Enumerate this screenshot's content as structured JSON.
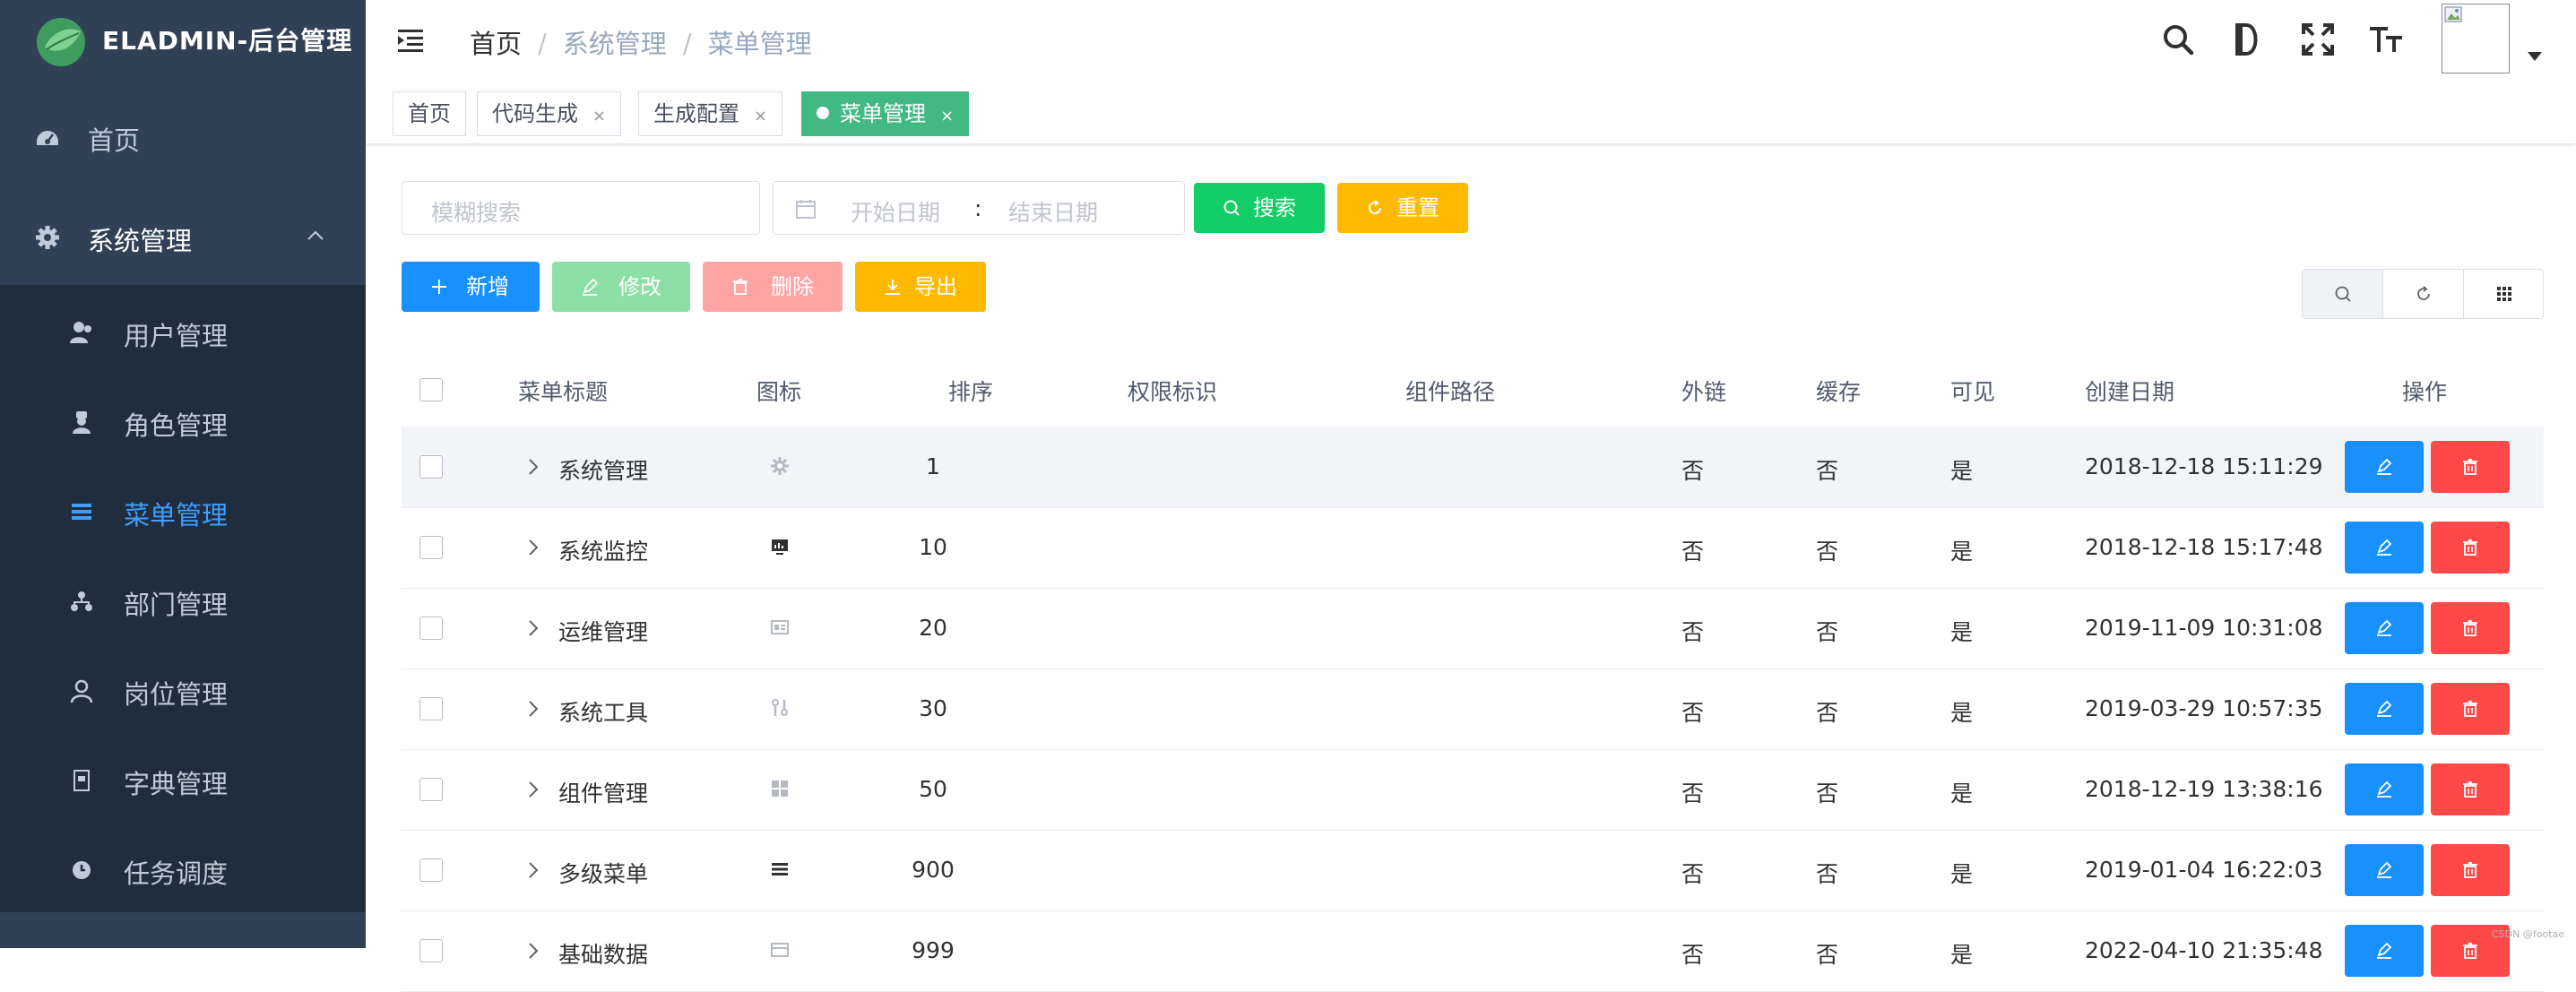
{
  "app": {
    "title": "ELADMIN-后台管理"
  },
  "sidebar": {
    "items": [
      {
        "label": "首页",
        "icon": "dashboard-icon"
      },
      {
        "label": "系统管理",
        "icon": "gear-icon",
        "expanded": true
      },
      {
        "label": "用户管理",
        "icon": "user-icon"
      },
      {
        "label": "角色管理",
        "icon": "role-icon"
      },
      {
        "label": "菜单管理",
        "icon": "menu-icon",
        "active": true
      },
      {
        "label": "部门管理",
        "icon": "dept-icon"
      },
      {
        "label": "岗位管理",
        "icon": "post-icon"
      },
      {
        "label": "字典管理",
        "icon": "dict-icon"
      },
      {
        "label": "任务调度",
        "icon": "timing-icon"
      }
    ]
  },
  "breadcrumb": [
    "首页",
    "系统管理",
    "菜单管理"
  ],
  "tags": [
    {
      "label": "首页"
    },
    {
      "label": "代码生成",
      "close": "×"
    },
    {
      "label": "生成配置",
      "close": "×"
    },
    {
      "label": "菜单管理",
      "close": "×",
      "active": true
    }
  ],
  "search": {
    "placeholder": "模糊搜索",
    "date_start_placeholder": "开始日期",
    "date_sep": ":",
    "date_end_placeholder": "结束日期",
    "search_label": "搜索",
    "reset_label": "重置"
  },
  "actions": {
    "add_label": "新增",
    "edit_label": "修改",
    "delete_label": "删除",
    "export_label": "导出"
  },
  "table": {
    "columns": [
      "菜单标题",
      "图标",
      "排序",
      "权限标识",
      "组件路径",
      "外链",
      "缓存",
      "可见",
      "创建日期",
      "操作"
    ],
    "rows": [
      {
        "title": "系统管理",
        "icon": "gear-icon",
        "sort": "1",
        "permission": "",
        "component": "",
        "iframe": "否",
        "cache": "否",
        "visible": "是",
        "created": "2018-12-18 15:11:29"
      },
      {
        "title": "系统监控",
        "icon": "monitor-icon",
        "sort": "10",
        "permission": "",
        "component": "",
        "iframe": "否",
        "cache": "否",
        "visible": "是",
        "created": "2018-12-18 15:17:48"
      },
      {
        "title": "运维管理",
        "icon": "mnt-icon",
        "sort": "20",
        "permission": "",
        "component": "",
        "iframe": "否",
        "cache": "否",
        "visible": "是",
        "created": "2019-11-09 10:31:08"
      },
      {
        "title": "系统工具",
        "icon": "tools-icon",
        "sort": "30",
        "permission": "",
        "component": "",
        "iframe": "否",
        "cache": "否",
        "visible": "是",
        "created": "2019-03-29 10:57:35"
      },
      {
        "title": "组件管理",
        "icon": "grid-icon",
        "sort": "50",
        "permission": "",
        "component": "",
        "iframe": "否",
        "cache": "否",
        "visible": "是",
        "created": "2018-12-19 13:38:16"
      },
      {
        "title": "多级菜单",
        "icon": "list-icon",
        "sort": "900",
        "permission": "",
        "component": "",
        "iframe": "否",
        "cache": "否",
        "visible": "是",
        "created": "2019-01-04 16:22:03"
      },
      {
        "title": "基础数据",
        "icon": "data-icon",
        "sort": "999",
        "permission": "",
        "component": "",
        "iframe": "否",
        "cache": "否",
        "visible": "是",
        "created": "2022-04-10 21:35:48"
      }
    ]
  },
  "watermark": "CSDN @footae",
  "colors": {
    "sidebar_bg": "#304156",
    "sidebar_sub_bg": "#1f2d3d",
    "active_text": "#409eff",
    "tag_active": "#42b983",
    "primary": "#1890ff",
    "success": "#13ce66",
    "warning": "#ffba00",
    "danger": "#ff4949"
  }
}
